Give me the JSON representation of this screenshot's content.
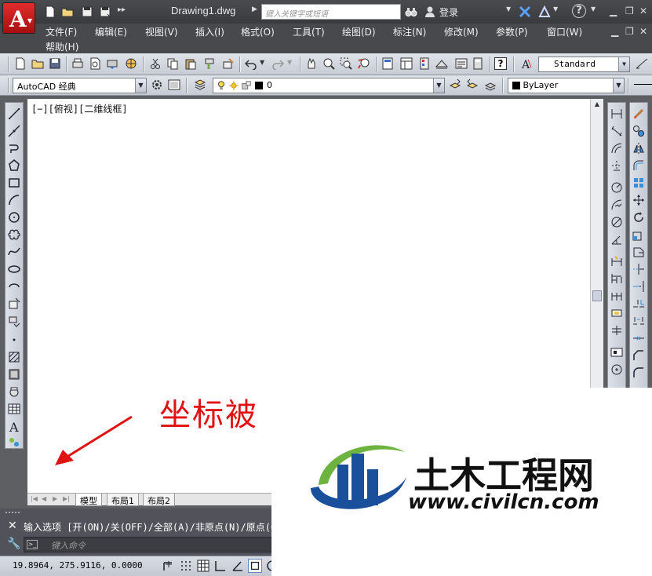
{
  "title_bar": {
    "document": "Drawing1.dwg",
    "search_placeholder": "键入关键字或短语",
    "login": "登录",
    "help": "?"
  },
  "menu": {
    "items": [
      "文件(F)",
      "编辑(E)",
      "视图(V)",
      "插入(I)",
      "格式(O)",
      "工具(T)",
      "绘图(D)",
      "标注(N)",
      "修改(M)",
      "参数(P)",
      "窗口(W)"
    ],
    "help": "帮助(H)"
  },
  "toolbars": {
    "text_style": "Standard",
    "workspace": "AutoCAD 经典",
    "layer": "0",
    "color": "ByLayer"
  },
  "drawing": {
    "view_label": "[−][俯视][二维线框]"
  },
  "tabs": [
    "模型",
    "布局1",
    "布局2"
  ],
  "command": {
    "history": "输入选项 [开(ON)/关(OFF)/全部(A)/非原点(N)/原点(OR)]",
    "input_placeholder": "键入命令"
  },
  "status": {
    "coords": "19.8964,  275.9116, 0.0000"
  },
  "annotation": {
    "text": "坐标被",
    "color": "#e01313"
  },
  "watermark": {
    "name": "土木工程网",
    "url": "www.civilcn.com"
  },
  "colors": {
    "app_red": "#c21a1a",
    "title_bar": "#3f4043",
    "toolbar": "#d2d6dd",
    "logo_blue": "#1a4f9c",
    "logo_green": "#6cb33f"
  }
}
